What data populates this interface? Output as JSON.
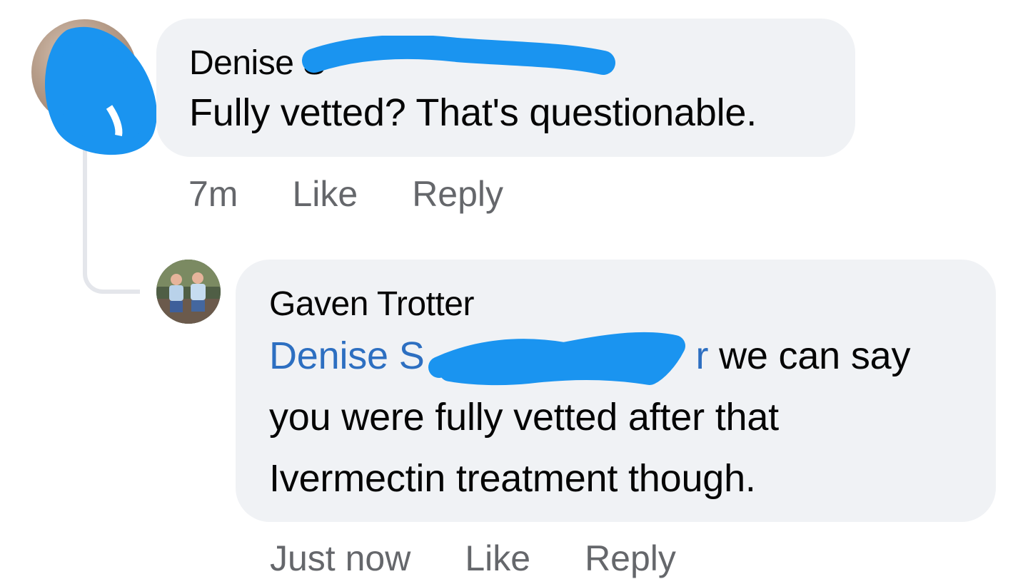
{
  "comment": {
    "author": "Denise S",
    "text": "Fully vetted?  That's questionable.",
    "time": "7m",
    "like_label": "Like",
    "reply_label": "Reply"
  },
  "reply": {
    "author": "Gaven Trotter",
    "mention": "Denise S",
    "mention_tail": "r",
    "text_line1": " we can say",
    "text_line2": "you were fully vetted after that",
    "text_line3": "Ivermectin treatment though.",
    "time": "Just now",
    "like_label": "Like",
    "reply_label": "Reply"
  },
  "colors": {
    "bubble": "#f0f2f5",
    "mention": "#2d6fc1",
    "redaction": "#1a94f0",
    "meta_text": "#65676b"
  }
}
